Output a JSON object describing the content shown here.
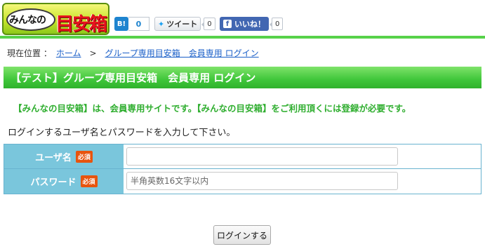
{
  "logo": {
    "text_part1": "みんなの",
    "text_part2": "目安箱"
  },
  "social": {
    "hatena": {
      "icon": "B!",
      "count": "0"
    },
    "twitter": {
      "label": "ツイート",
      "count": "0"
    },
    "facebook": {
      "label": "いいね！",
      "count": "0"
    }
  },
  "breadcrumb": {
    "current_label": "現在位置 ：",
    "home": "ホーム",
    "separator": ">",
    "page": "グループ専用目安箱　会員専用 ログイン"
  },
  "page_title": "【テスト】グループ専用目安箱　会員専用 ログイン",
  "notice": "【みんなの目安箱】は、会員専用サイトです。【みんなの目安箱】をご利用頂くには登録が必要です。",
  "instruction": "ログインするユーザ名とパスワードを入力して下さい。",
  "form": {
    "username_label": "ユーザ名",
    "username_value": "",
    "password_label": "パスワード",
    "password_placeholder": "半角英数16文字以内",
    "required_badge": "必須"
  },
  "login_button": "ログインする",
  "colors": {
    "accent_green": "#3fc63a",
    "label_blue": "#7ac6dc",
    "required_orange": "#e8540e",
    "link_blue": "#1a5fc8"
  }
}
